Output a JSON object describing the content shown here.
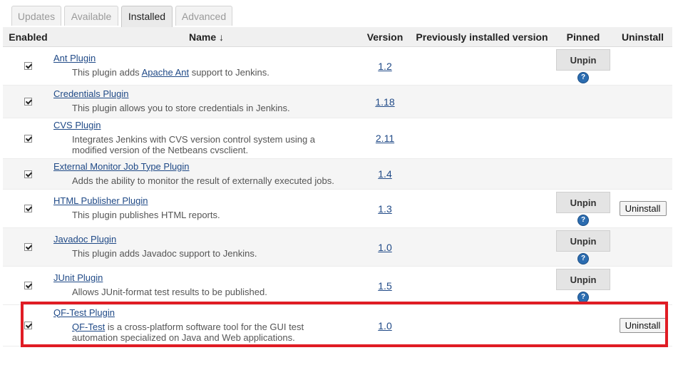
{
  "tabs": [
    {
      "label": "Updates",
      "active": false
    },
    {
      "label": "Available",
      "active": false
    },
    {
      "label": "Installed",
      "active": true
    },
    {
      "label": "Advanced",
      "active": false
    }
  ],
  "columns": {
    "enabled": "Enabled",
    "name": "Name ↓",
    "version": "Version",
    "previous": "Previously installed version",
    "pinned": "Pinned",
    "uninstall": "Uninstall"
  },
  "buttons": {
    "unpin": "Unpin",
    "uninstall": "Uninstall",
    "help": "?"
  },
  "plugins": [
    {
      "name": "Ant Plugin",
      "desc_pre": "This plugin adds ",
      "desc_link": "Apache Ant",
      "desc_post": " support to Jenkins.",
      "version": "1.2",
      "enabled": true,
      "pinned": true,
      "uninstallable": false
    },
    {
      "name": "Credentials Plugin",
      "desc_pre": "This plugin allows you to store credentials in Jenkins.",
      "desc_link": "",
      "desc_post": "",
      "version": "1.18",
      "enabled": true,
      "pinned": false,
      "uninstallable": false
    },
    {
      "name": "CVS Plugin",
      "desc_pre": "Integrates Jenkins with CVS version control system using a modified version of the Netbeans cvsclient.",
      "desc_link": "",
      "desc_post": "",
      "version": "2.11",
      "enabled": true,
      "pinned": false,
      "uninstallable": false
    },
    {
      "name": "External Monitor Job Type Plugin",
      "desc_pre": "Adds the ability to monitor the result of externally executed jobs.",
      "desc_link": "",
      "desc_post": "",
      "version": "1.4",
      "enabled": true,
      "pinned": false,
      "uninstallable": false
    },
    {
      "name": "HTML Publisher Plugin",
      "desc_pre": "This plugin publishes HTML reports.",
      "desc_link": "",
      "desc_post": "",
      "version": "1.3",
      "enabled": true,
      "pinned": true,
      "uninstallable": true
    },
    {
      "name": "Javadoc Plugin",
      "desc_pre": "This plugin adds Javadoc support to Jenkins.",
      "desc_link": "",
      "desc_post": "",
      "version": "1.0",
      "enabled": true,
      "pinned": true,
      "uninstallable": false
    },
    {
      "name": "JUnit Plugin",
      "desc_pre": "Allows JUnit-format test results to be published.",
      "desc_link": "",
      "desc_post": "",
      "version": "1.5",
      "enabled": true,
      "pinned": true,
      "uninstallable": false
    },
    {
      "name": "QF-Test Plugin",
      "desc_pre": "",
      "desc_link": "QF-Test",
      "desc_post": " is a cross-platform software tool for the GUI test automation specialized on Java and Web applications.",
      "version": "1.0",
      "enabled": true,
      "pinned": false,
      "uninstallable": true
    }
  ],
  "highlight_color": "#e01c24"
}
